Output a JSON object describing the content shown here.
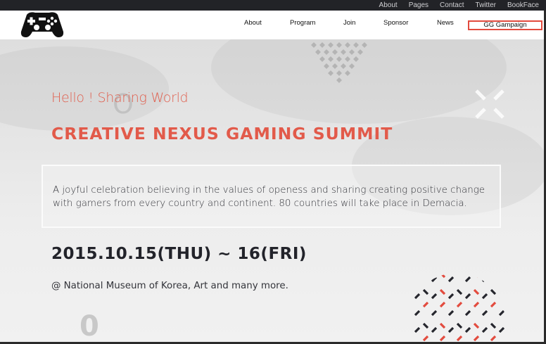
{
  "top_links": [
    "About",
    "Pages",
    "Contact",
    "Twitter",
    "BookFace"
  ],
  "nav": {
    "items": [
      "About",
      "Program",
      "Join",
      "Sponsor",
      "News"
    ],
    "campaign_label": "GG Gampaign"
  },
  "hero": {
    "greeting": "Hello ! Sharing World",
    "title": "CREATIVE NEXUS GAMING SUMMIT",
    "description": "A joyful celebration believing in the values of openess and sharing creating positive change with gamers from every country and continent. 80 countries will take place in Demacia.",
    "date": "2015.10.15(THU) ~ 16(FRI)",
    "venue": "@ National Museum of Korea, Art and many more."
  },
  "colors": {
    "accent": "#e25a4a",
    "topbar": "#222327",
    "dark_text": "#22232a"
  },
  "icons": {
    "logo": "gamepad-icon",
    "close_x": "x-mark-icon"
  }
}
